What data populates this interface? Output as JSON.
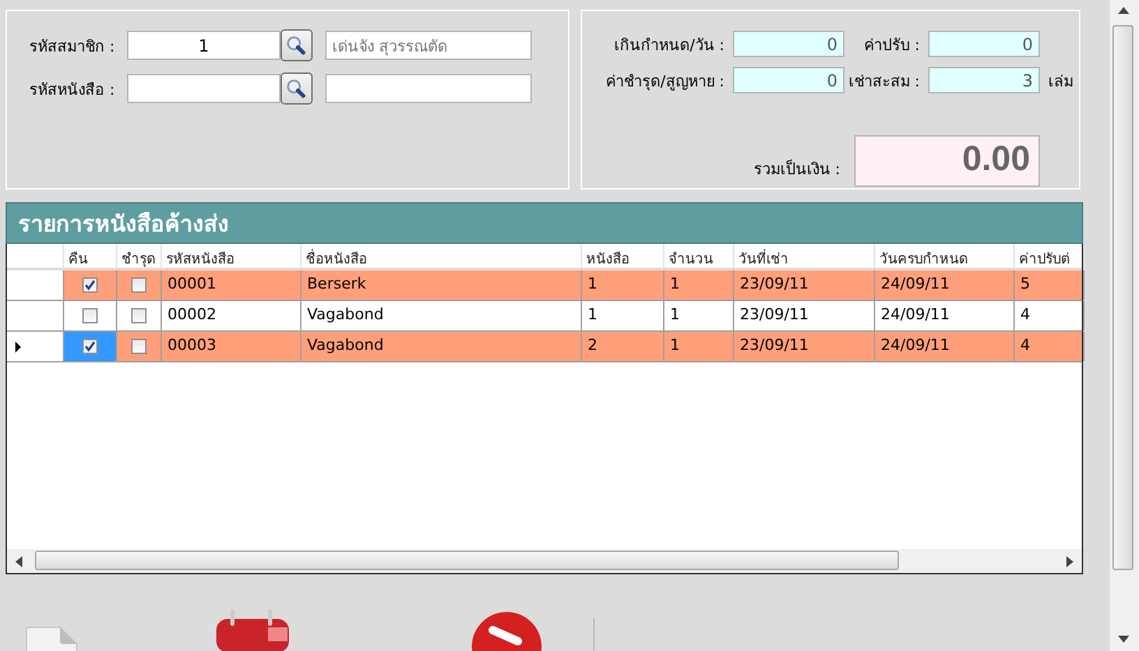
{
  "member": {
    "label": "รหัสสมาชิก :",
    "code": "1",
    "name": "เด่นจัง สุวรรณตัด"
  },
  "book": {
    "label": "รหัสหนังสือ :"
  },
  "summary": {
    "fields": [
      {
        "label": "เกินกำหนด/วัน :",
        "value": "0"
      },
      {
        "label": "ค่าปรับ :",
        "value": "0"
      },
      {
        "label": "ค่าชำรุด/สูญหาย :",
        "value": "0"
      },
      {
        "label": "เช่าสะสม :",
        "value": "3",
        "unit": "เล่ม"
      }
    ],
    "total": {
      "label": "รวมเป็นเงิน :",
      "value": "0.00"
    }
  },
  "grid": {
    "title": "รายการหนังสือค้างส่ง",
    "columns": [
      "คืน",
      "ชำรุด",
      "รหัสหนังสือ",
      "ชื่อหนังสือ",
      "หนังสือ",
      "จำนวน",
      "วันที่เช่า",
      "วันครบกำหนด",
      "ค่าปรับต่"
    ],
    "rows": [
      {
        "returned": true,
        "damaged": false,
        "book_code": "00001",
        "title": "Berserk",
        "copy": "1",
        "quantity": "1",
        "rent_date": "23/09/11",
        "due_date": "24/09/11",
        "fine": "5",
        "highlighted": true,
        "current": false
      },
      {
        "returned": false,
        "damaged": false,
        "book_code": "00002",
        "title": "Vagabond",
        "copy": "1",
        "quantity": "1",
        "rent_date": "23/09/11",
        "due_date": "24/09/11",
        "fine": "4",
        "highlighted": false,
        "current": false
      },
      {
        "returned": true,
        "damaged": false,
        "book_code": "00003",
        "title": "Vagabond",
        "copy": "2",
        "quantity": "1",
        "rent_date": "23/09/11",
        "due_date": "24/09/11",
        "fine": "4",
        "highlighted": true,
        "current": true
      }
    ]
  }
}
